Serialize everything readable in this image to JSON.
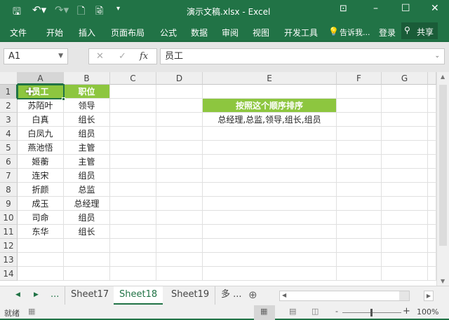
{
  "title": "演示文稿.xlsx - Excel",
  "ribbon_tabs": [
    "文件",
    "开始",
    "插入",
    "页面布局",
    "公式",
    "数据",
    "审阅",
    "视图",
    "开发工具"
  ],
  "tell_me": "告诉我...",
  "login": "登录",
  "share": "共享",
  "name_box": "A1",
  "fx": "fx",
  "formula_value": "员工",
  "columns": [
    "A",
    "B",
    "C",
    "D",
    "E",
    "F",
    "G"
  ],
  "rows": [
    "1",
    "2",
    "3",
    "4",
    "5",
    "6",
    "7",
    "8",
    "9",
    "10",
    "11",
    "12",
    "13",
    "14"
  ],
  "col_a": [
    "员工",
    "苏陌叶",
    "白真",
    "白凤九",
    "燕池悟",
    "姬蘅",
    "连宋",
    "折颜",
    "成玉",
    "司命",
    "东华"
  ],
  "col_b": [
    "职位",
    "领导",
    "组长",
    "组员",
    "主管",
    "主管",
    "组员",
    "总监",
    "总经理",
    "组员",
    "组长"
  ],
  "e2": "按照这个顺序排序",
  "e3": "总经理,总监,领导,组长,组员",
  "sheets": [
    "Sheet17",
    "Sheet18",
    "Sheet19"
  ],
  "active_sheet": "Sheet18",
  "more_sheets": "多 ...",
  "ellipsis": "...",
  "status": "就绪",
  "zoom": "100%",
  "accent": "#217346",
  "header_fill": "#8dc63f"
}
